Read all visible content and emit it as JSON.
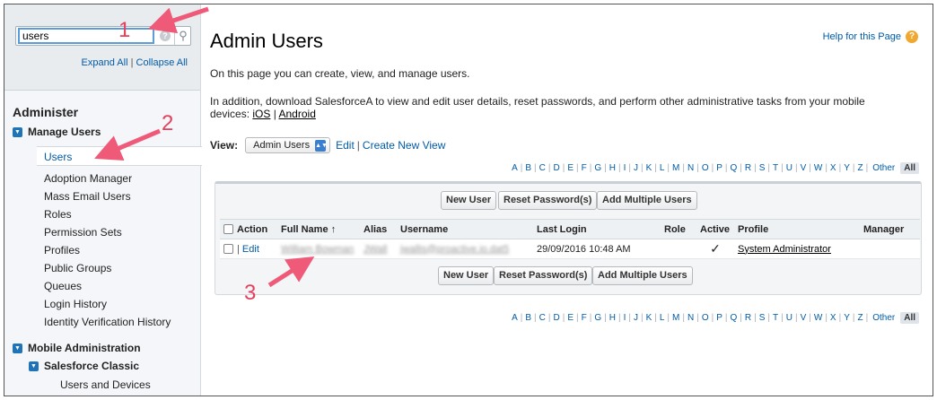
{
  "search": {
    "value": "users"
  },
  "sidebar": {
    "expand_all": "Expand All",
    "collapse_all": "Collapse All",
    "separator": "|",
    "section_title": "Administer",
    "manage_users": {
      "label": "Manage Users",
      "items": [
        "Users",
        "Adoption Manager",
        "Mass Email Users",
        "Roles",
        "Permission Sets",
        "Profiles",
        "Public Groups",
        "Queues",
        "Login History",
        "Identity Verification History"
      ]
    },
    "mobile_admin": {
      "label": "Mobile Administration"
    },
    "salesforce_classic": {
      "label": "Salesforce Classic",
      "items": [
        "Users and Devices"
      ]
    }
  },
  "main": {
    "title": "Admin Users",
    "help_link": "Help for this Page",
    "intro1": "On this page you can create, view, and manage users.",
    "intro2_before": "In addition, download SalesforceA to view and edit user details, reset passwords, and perform other administrative tasks from your mobile devices: ",
    "ios_link": "iOS",
    "intro2_sep": " | ",
    "android_link": "Android",
    "view_label": "View:",
    "view_selected": "Admin Users",
    "edit_link": "Edit",
    "view_sep": "|",
    "create_view_link": "Create New View"
  },
  "alphabet": {
    "letters": [
      "A",
      "B",
      "C",
      "D",
      "E",
      "F",
      "G",
      "H",
      "I",
      "J",
      "K",
      "L",
      "M",
      "N",
      "O",
      "P",
      "Q",
      "R",
      "S",
      "T",
      "U",
      "V",
      "W",
      "X",
      "Y",
      "Z"
    ],
    "other": "Other",
    "all": "All"
  },
  "buttons": {
    "new_user": "New User",
    "reset_password": "Reset Password(s)",
    "add_multiple": "Add Multiple Users"
  },
  "table": {
    "headers": {
      "action": "Action",
      "full_name": "Full Name",
      "sort_arrow": "↑",
      "alias": "Alias",
      "username": "Username",
      "last_login": "Last Login",
      "role": "Role",
      "active": "Active",
      "profile": "Profile",
      "manager": "Manager"
    },
    "rows": [
      {
        "edit": "Edit",
        "action_sep": "|",
        "full_name": "William Bowman",
        "alias": "JWall",
        "username": "jwallis@proactive.io.dat5",
        "last_login": "29/09/2016 10:48 AM",
        "role": "",
        "active": "✓",
        "profile": "System Administrator",
        "manager": ""
      }
    ]
  },
  "annotations": {
    "one": "1",
    "two": "2",
    "three": "3",
    "color": "#e4415e"
  }
}
